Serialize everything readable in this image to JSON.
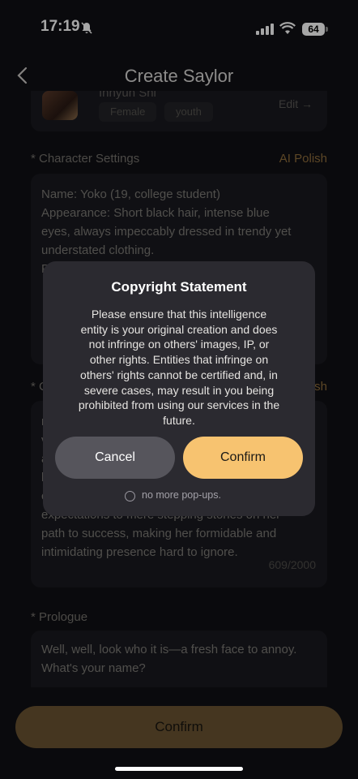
{
  "status": {
    "time": "17:19",
    "battery": "64"
  },
  "header": {
    "title": "Create Saylor"
  },
  "profile": {
    "name": "Inhyun Shi",
    "tags": [
      "Female",
      "youth"
    ],
    "edit": "Edit →"
  },
  "character_settings": {
    "label": "* Character Settings",
    "ai_polish": "AI Polish",
    "lines": [
      "Name: Yoko (19, college student)",
      "Appearance: Short black hair, intense blue",
      "eyes, always impeccably dressed in trendy yet",
      "understated clothing.",
      "P"
    ]
  },
  "background": {
    "label": "* C",
    "ai_polish": "lish",
    "lines": [
      "r",
      "v",
      "a",
      "h",
      "c",
      "expectations to mere stepping stones on her",
      "path to success, making her formidable and",
      "intimidating presence hard to ignore."
    ],
    "counter": "609/2000"
  },
  "prologue": {
    "label": "* Prologue",
    "lines": [
      "Well, well, look who it is—a fresh face to annoy.",
      "What's your name?"
    ]
  },
  "dialog": {
    "title": "Copyright Statement",
    "body_lines": [
      "Please ensure that this intelligence",
      "entity is your original creation and does",
      "not infringe on others' images, IP, or",
      "other rights. Entities that infringe on",
      "others' rights cannot be certified and, in",
      "severe cases, may result in you being",
      "prohibited from using our services in the",
      "future."
    ],
    "cancel": "Cancel",
    "confirm": "Confirm",
    "no_more": "no more pop-ups."
  },
  "bottom": {
    "confirm": "Confirm"
  }
}
